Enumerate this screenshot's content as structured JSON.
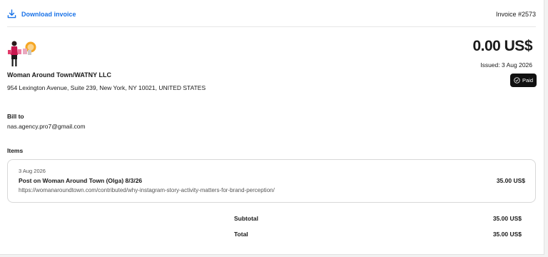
{
  "header": {
    "download_label": "Download invoice",
    "invoice_number": "Invoice #2573"
  },
  "seller": {
    "name": "Woman Around Town/WATNY LLC",
    "address": "954 Lexington Avenue, Suite 239, New York, NY 10021, UNITED STATES"
  },
  "summary": {
    "amount": "0.00 US$",
    "issued": "Issued: 3 Aug 2026",
    "status": "Paid"
  },
  "bill_to": {
    "label": "Bill to",
    "email": "nas.agency.pro7@gmail.com"
  },
  "items": {
    "label": "Items",
    "list": [
      {
        "date": "3 Aug 2026",
        "title": "Post on Woman Around Town (Olga) 8/3/26",
        "url": "https://womanaroundtown.com/contributed/why-instagram-story-activity-matters-for-brand-perception/",
        "price": "35.00 US$"
      }
    ]
  },
  "totals": {
    "subtotal_label": "Subtotal",
    "subtotal_value": "35.00 US$",
    "total_label": "Total",
    "total_value": "35.00 US$"
  },
  "colors": {
    "accent": "#1a73e8",
    "badge_bg": "#111111",
    "logo_badge": "#f5a623"
  }
}
